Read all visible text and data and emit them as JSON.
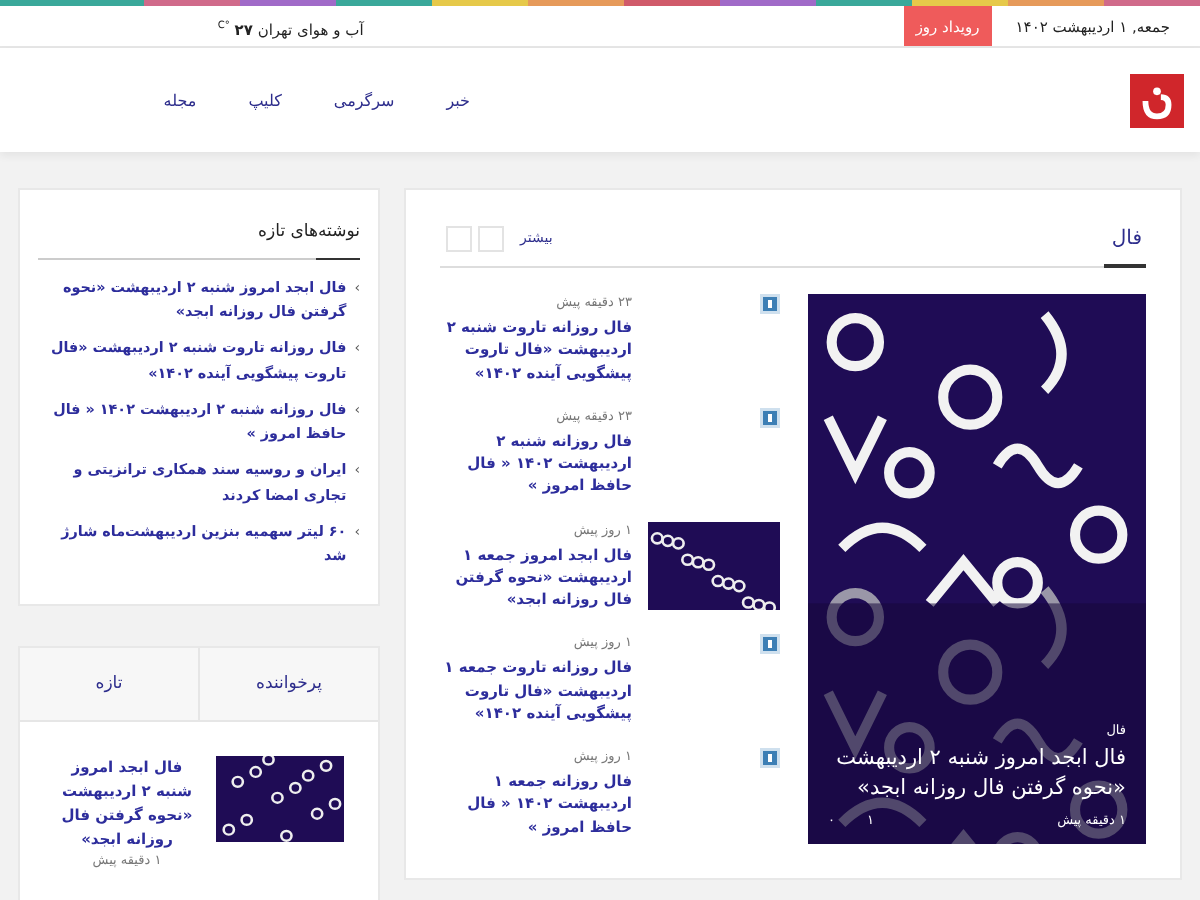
{
  "top_bar": {
    "date": "جمعه, ۱ اردیبهشت ۱۴۰۲",
    "badge": "رویداد روز",
    "weather": "آب و هوای تهران **۲۷** $^{°C}$"
  },
  "nav": [
    "خبر",
    "سرگرمی",
    "کلیپ",
    "مجله"
  ],
  "main": {
    "title": "فال",
    "more": "بیشتر",
    "feature": {
      "category": "فال",
      "title": "فال ابجد امروز شنبه ۲ اردیبهشت «نحوه گرفتن فال روزانه ابجد»",
      "time": "۱ دقیقه پیش",
      "stats": [
        "۱",
        "۰"
      ]
    },
    "items": [
      {
        "kind": "icon",
        "time": "۲۳ دقیقه پیش",
        "title": "فال روزانه تاروت شنبه ۲ اردیبهشت «فال تاروت پیشگویی آینده ۱۴۰۲»"
      },
      {
        "kind": "icon",
        "time": "۲۳ دقیقه پیش",
        "title": "فال روزانه شنبه ۲ اردیبهشت ۱۴۰۲ « فال حافظ امروز »"
      },
      {
        "kind": "picture",
        "time": "۱ روز پیش",
        "title": "فال ابجد امروز جمعه ۱ اردیبهشت «نحوه گرفتن فال روزانه ابجد»"
      },
      {
        "kind": "icon",
        "time": "۱ روز پیش",
        "title": "فال روزانه تاروت جمعه ۱ اردیبهشت «فال تاروت پیشگویی آینده ۱۴۰۲»"
      },
      {
        "kind": "icon",
        "time": "۱ روز پیش",
        "title": "فال روزانه جمعه ۱ اردیبهشت ۱۴۰۲ « فال حافظ امروز »"
      }
    ]
  },
  "sidebar": {
    "title": "نوشته‌های تازه",
    "chevron": "›",
    "posts": [
      "فال ابجد امروز شنبه ۲ اردیبهشت «نحوه گرفتن فال روزانه ابجد»",
      "فال روزانه تاروت شنبه ۲ اردیبهشت «فال تاروت پیشگویی آینده ۱۴۰۲»",
      "فال روزانه شنبه ۲ اردیبهشت ۱۴۰۲ « فال حافظ امروز »",
      "ایران و روسیه سند همکاری ترانزیتی و تجاری امضا کردند",
      "۶۰ لیتر سهمیه بنزین اردیبهشت‌ماه شارژ شد"
    ]
  },
  "tabs_panel": {
    "tabs": [
      "پرخواننده",
      "تازه"
    ],
    "items": [
      {
        "title": "فال ابجد امروز شنبه ۲ اردیبهشت «نحوه گرفتن فال روزانه ابجد»",
        "time": "۱ دقیقه پیش"
      }
    ]
  }
}
